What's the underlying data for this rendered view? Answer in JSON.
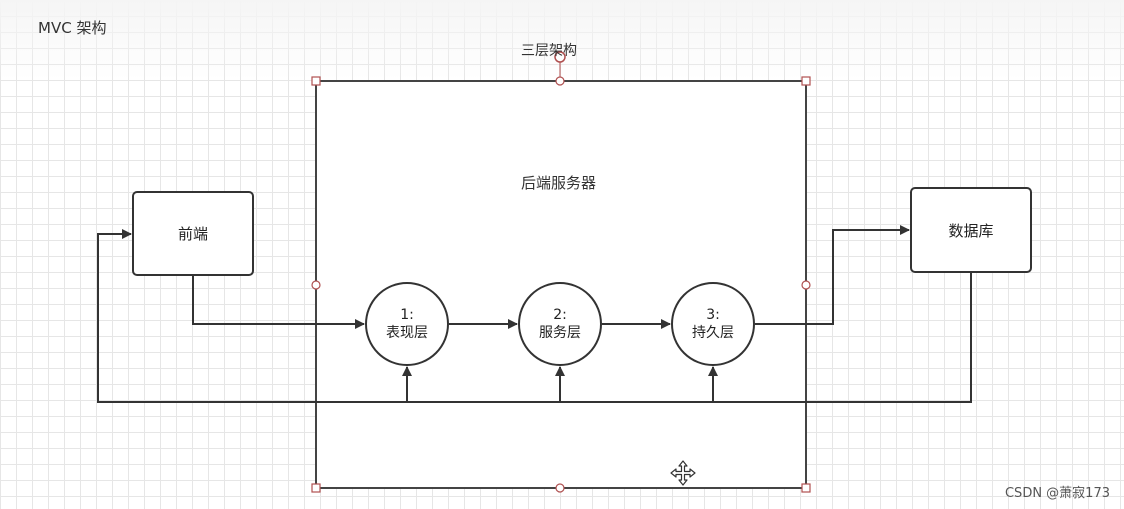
{
  "page_title": "MVC 架构",
  "container_label": "三层架构",
  "server_label": "后端服务器",
  "frontend_label": "前端",
  "database_label": "数据库",
  "layers": [
    {
      "num": "1:",
      "name": "表现层"
    },
    {
      "num": "2:",
      "name": "服务层"
    },
    {
      "num": "3:",
      "name": "持久层"
    }
  ],
  "watermark": "CSDN @萧寂173",
  "colors": {
    "stroke": "#333333",
    "handle": "#b05050",
    "grid": "#e6e6e6"
  }
}
